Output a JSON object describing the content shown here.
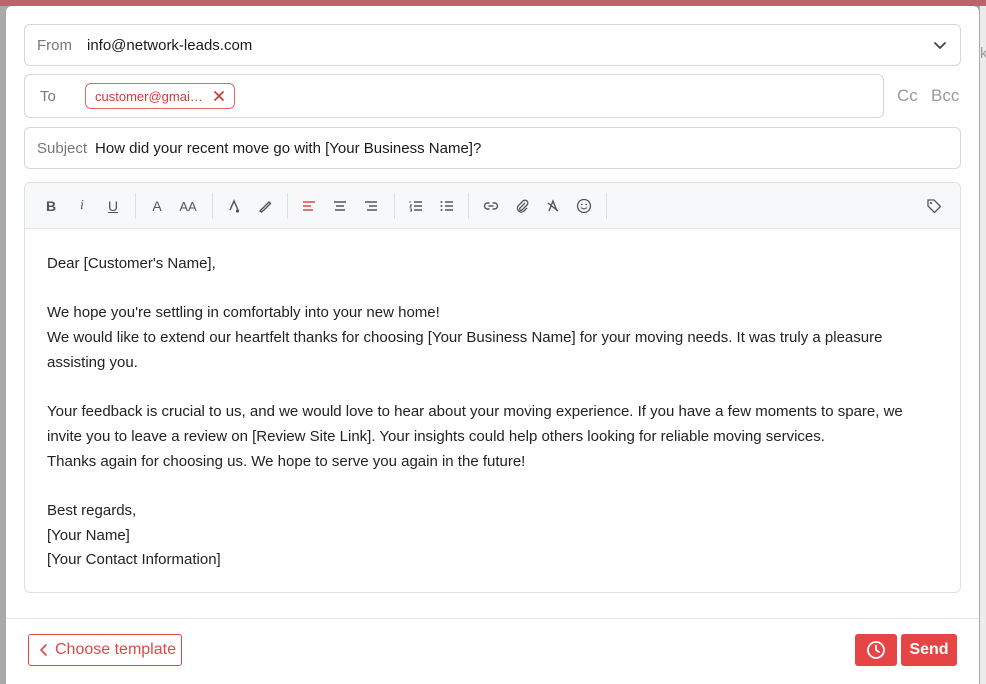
{
  "from": {
    "label": "From",
    "value": "info@network-leads.com"
  },
  "to": {
    "label": "To",
    "recipient": "customer@gmai…"
  },
  "cc_label": "Cc",
  "bcc_label": "Bcc",
  "subject": {
    "label": "Subject",
    "value": "How did your recent move go with [Your Business Name]?"
  },
  "toolbar": {
    "bold": "B",
    "italic": "i",
    "underline": "U",
    "font_size": "A",
    "font_case": "AA"
  },
  "body": {
    "greeting": "Dear [Customer's Name],",
    "line1": "We hope you're settling in comfortably into your new home!",
    "line2a": "We would like to extend our heartfelt thanks for choosing [Your Business Name] for your moving needs. It was truly a pleasure",
    "line2b": "assisting you.",
    "line3a": "Your feedback is crucial to us, and we would love to hear about your moving experience. If you have a few moments to spare, we",
    "line3b": "invite you to leave a review on [Review Site Link]. Your insights could help others looking for reliable moving services.",
    "line4": "Thanks again for choosing us. We hope to serve you again in the future!",
    "closing": "Best regards,",
    "name": "[Your Name]",
    "contact": "[Your Contact Information]"
  },
  "footer": {
    "choose_template": "Choose template",
    "send": "Send"
  },
  "colors": {
    "accent": "#e64545",
    "chip": "#d33a3a"
  },
  "background_fragment": "k"
}
